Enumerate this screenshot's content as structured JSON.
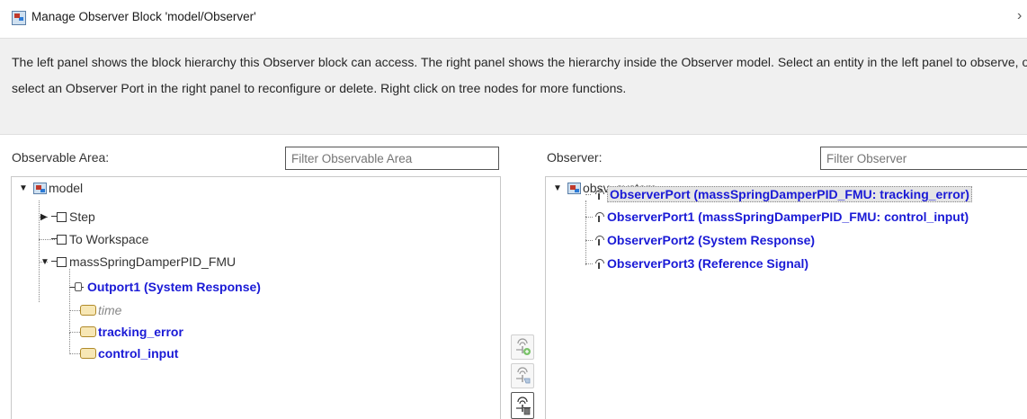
{
  "window": {
    "title": "Manage Observer Block 'model/Observer'",
    "close_glyph": "›"
  },
  "info": {
    "text": "The left panel shows the block hierarchy this Observer block can access. The right panel shows the hierarchy inside the Observer model. Select an entity in the left panel to observe, or select an Observer Port in the right panel to reconfigure or delete. Right click on tree nodes for more functions."
  },
  "left": {
    "label": "Observable Area:",
    "filter_placeholder": "Filter Observable Area",
    "tree": {
      "root": "model",
      "step": "Step",
      "to_workspace": "To Workspace",
      "fmu": "massSpringDamperPID_FMU",
      "outport": "Outport1 (System Response)",
      "time": "time",
      "tracking_error": "tracking_error",
      "control_input": "control_input"
    }
  },
  "right": {
    "label": "Observer:",
    "filter_placeholder": "Filter Observer",
    "tree": {
      "root": "obsv_system",
      "ports": [
        "ObserverPort (massSpringDamperPID_FMU: tracking_error)",
        "ObserverPort1 (massSpringDamperPID_FMU: control_input)",
        "ObserverPort2 (System Response)",
        "ObserverPort3 (Reference Signal)"
      ]
    }
  },
  "middle_buttons": {
    "add_icon": "add-observer-port-icon",
    "reconfigure_icon": "reconfigure-observer-port-icon",
    "delete_icon": "delete-observer-port-icon"
  },
  "colors": {
    "link_blue": "#1a1ad6",
    "info_bg": "#f0f0f0"
  }
}
